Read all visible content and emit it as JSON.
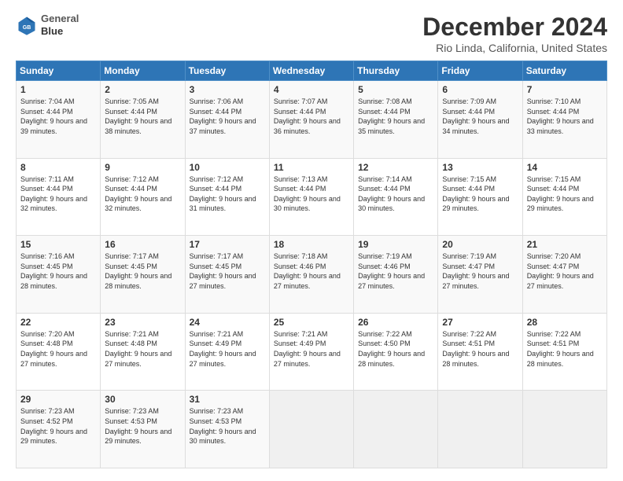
{
  "logo": {
    "line1": "General",
    "line2": "Blue"
  },
  "title": "December 2024",
  "subtitle": "Rio Linda, California, United States",
  "weekdays": [
    "Sunday",
    "Monday",
    "Tuesday",
    "Wednesday",
    "Thursday",
    "Friday",
    "Saturday"
  ],
  "weeks": [
    [
      {
        "day": "1",
        "sunrise": "7:04 AM",
        "sunset": "4:44 PM",
        "daylight": "9 hours and 39 minutes."
      },
      {
        "day": "2",
        "sunrise": "7:05 AM",
        "sunset": "4:44 PM",
        "daylight": "9 hours and 38 minutes."
      },
      {
        "day": "3",
        "sunrise": "7:06 AM",
        "sunset": "4:44 PM",
        "daylight": "9 hours and 37 minutes."
      },
      {
        "day": "4",
        "sunrise": "7:07 AM",
        "sunset": "4:44 PM",
        "daylight": "9 hours and 36 minutes."
      },
      {
        "day": "5",
        "sunrise": "7:08 AM",
        "sunset": "4:44 PM",
        "daylight": "9 hours and 35 minutes."
      },
      {
        "day": "6",
        "sunrise": "7:09 AM",
        "sunset": "4:44 PM",
        "daylight": "9 hours and 34 minutes."
      },
      {
        "day": "7",
        "sunrise": "7:10 AM",
        "sunset": "4:44 PM",
        "daylight": "9 hours and 33 minutes."
      }
    ],
    [
      {
        "day": "8",
        "sunrise": "7:11 AM",
        "sunset": "4:44 PM",
        "daylight": "9 hours and 32 minutes."
      },
      {
        "day": "9",
        "sunrise": "7:12 AM",
        "sunset": "4:44 PM",
        "daylight": "9 hours and 32 minutes."
      },
      {
        "day": "10",
        "sunrise": "7:12 AM",
        "sunset": "4:44 PM",
        "daylight": "9 hours and 31 minutes."
      },
      {
        "day": "11",
        "sunrise": "7:13 AM",
        "sunset": "4:44 PM",
        "daylight": "9 hours and 30 minutes."
      },
      {
        "day": "12",
        "sunrise": "7:14 AM",
        "sunset": "4:44 PM",
        "daylight": "9 hours and 30 minutes."
      },
      {
        "day": "13",
        "sunrise": "7:15 AM",
        "sunset": "4:44 PM",
        "daylight": "9 hours and 29 minutes."
      },
      {
        "day": "14",
        "sunrise": "7:15 AM",
        "sunset": "4:44 PM",
        "daylight": "9 hours and 29 minutes."
      }
    ],
    [
      {
        "day": "15",
        "sunrise": "7:16 AM",
        "sunset": "4:45 PM",
        "daylight": "9 hours and 28 minutes."
      },
      {
        "day": "16",
        "sunrise": "7:17 AM",
        "sunset": "4:45 PM",
        "daylight": "9 hours and 28 minutes."
      },
      {
        "day": "17",
        "sunrise": "7:17 AM",
        "sunset": "4:45 PM",
        "daylight": "9 hours and 27 minutes."
      },
      {
        "day": "18",
        "sunrise": "7:18 AM",
        "sunset": "4:46 PM",
        "daylight": "9 hours and 27 minutes."
      },
      {
        "day": "19",
        "sunrise": "7:19 AM",
        "sunset": "4:46 PM",
        "daylight": "9 hours and 27 minutes."
      },
      {
        "day": "20",
        "sunrise": "7:19 AM",
        "sunset": "4:47 PM",
        "daylight": "9 hours and 27 minutes."
      },
      {
        "day": "21",
        "sunrise": "7:20 AM",
        "sunset": "4:47 PM",
        "daylight": "9 hours and 27 minutes."
      }
    ],
    [
      {
        "day": "22",
        "sunrise": "7:20 AM",
        "sunset": "4:48 PM",
        "daylight": "9 hours and 27 minutes."
      },
      {
        "day": "23",
        "sunrise": "7:21 AM",
        "sunset": "4:48 PM",
        "daylight": "9 hours and 27 minutes."
      },
      {
        "day": "24",
        "sunrise": "7:21 AM",
        "sunset": "4:49 PM",
        "daylight": "9 hours and 27 minutes."
      },
      {
        "day": "25",
        "sunrise": "7:21 AM",
        "sunset": "4:49 PM",
        "daylight": "9 hours and 27 minutes."
      },
      {
        "day": "26",
        "sunrise": "7:22 AM",
        "sunset": "4:50 PM",
        "daylight": "9 hours and 28 minutes."
      },
      {
        "day": "27",
        "sunrise": "7:22 AM",
        "sunset": "4:51 PM",
        "daylight": "9 hours and 28 minutes."
      },
      {
        "day": "28",
        "sunrise": "7:22 AM",
        "sunset": "4:51 PM",
        "daylight": "9 hours and 28 minutes."
      }
    ],
    [
      {
        "day": "29",
        "sunrise": "7:23 AM",
        "sunset": "4:52 PM",
        "daylight": "9 hours and 29 minutes."
      },
      {
        "day": "30",
        "sunrise": "7:23 AM",
        "sunset": "4:53 PM",
        "daylight": "9 hours and 29 minutes."
      },
      {
        "day": "31",
        "sunrise": "7:23 AM",
        "sunset": "4:53 PM",
        "daylight": "9 hours and 30 minutes."
      },
      null,
      null,
      null,
      null
    ]
  ]
}
